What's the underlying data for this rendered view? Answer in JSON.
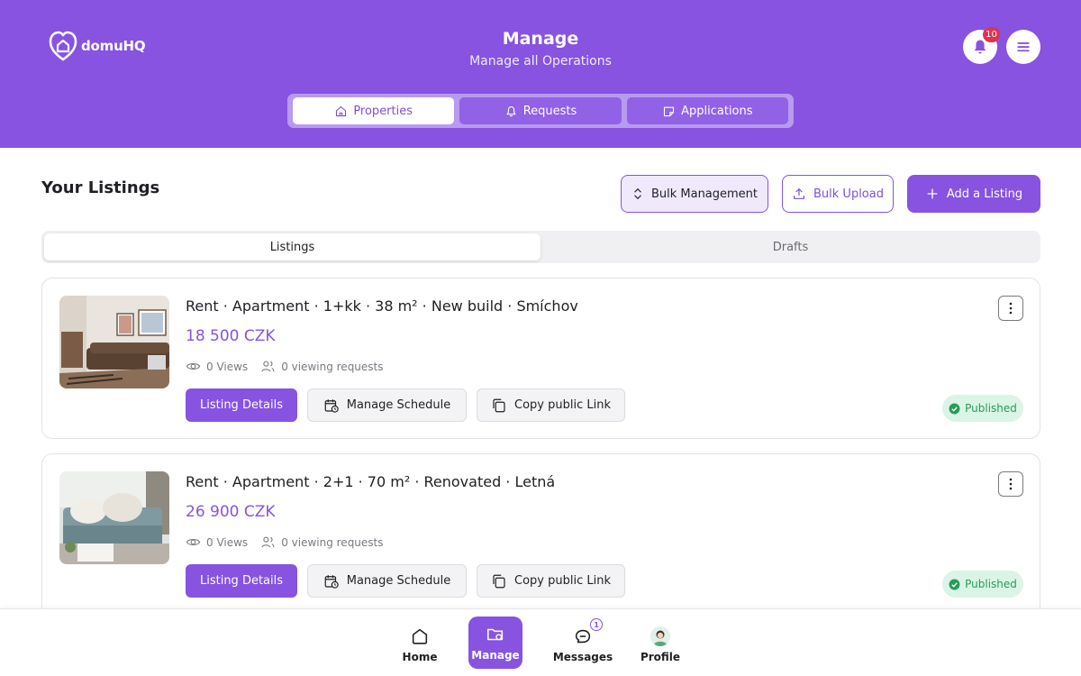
{
  "brand": {
    "name": "domuHQ"
  },
  "header": {
    "title": "Manage",
    "subtitle": "Manage all Operations",
    "notifications_count": "10",
    "tabs": [
      {
        "label": "Properties",
        "icon": "home-icon",
        "active": true
      },
      {
        "label": "Requests",
        "icon": "bell-icon",
        "active": false
      },
      {
        "label": "Applications",
        "icon": "note-icon",
        "active": false
      }
    ]
  },
  "listings": {
    "title": "Your Listings",
    "actions": {
      "bulk_management": "Bulk Management",
      "bulk_upload": "Bulk Upload",
      "add_listing": "Add a Listing"
    },
    "subtabs": {
      "listings": "Listings",
      "drafts": "Drafts"
    },
    "items": [
      {
        "title": "Rent · Apartment · 1+kk · 38 m² · New build · Smíchov",
        "price": "18 500 CZK",
        "views": "0 Views",
        "requests": "0 viewing requests",
        "details_label": "Listing Details",
        "schedule_label": "Manage Schedule",
        "copy_label": "Copy public Link",
        "status": "Published"
      },
      {
        "title": "Rent · Apartment · 2+1 · 70 m² · Renovated · Letná",
        "price": "26 900 CZK",
        "views": "0 Views",
        "requests": "0 viewing requests",
        "details_label": "Listing Details",
        "schedule_label": "Manage Schedule",
        "copy_label": "Copy public Link",
        "status": "Published"
      }
    ]
  },
  "bottom_nav": {
    "home": "Home",
    "manage": "Manage",
    "messages": "Messages",
    "messages_badge": "1",
    "profile": "Profile"
  },
  "colors": {
    "primary": "#8753e0",
    "published_bg": "#daf5e5",
    "published_text": "#2b9a5a",
    "badge_red": "#e0334f"
  }
}
